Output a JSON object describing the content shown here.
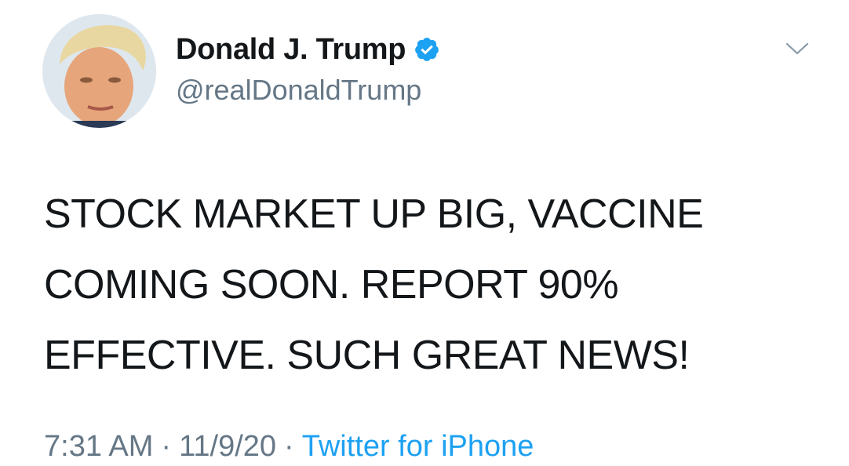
{
  "author": {
    "display_name": "Donald J. Trump",
    "handle": "@realDonaldTrump",
    "verified": true,
    "avatar_icon": "profile-photo",
    "verified_icon": "verified-badge-icon"
  },
  "tweet": {
    "lines": [
      "STOCK MARKET UP BIG, VACCINE",
      "COMING SOON. REPORT 90%",
      "EFFECTIVE. SUCH GREAT NEWS!"
    ]
  },
  "meta": {
    "time": "7:31 AM",
    "separator": "·",
    "date": "11/9/20",
    "source": "Twitter for iPhone"
  },
  "menu": {
    "icon": "chevron-down-icon"
  },
  "colors": {
    "accent": "#1da1f2",
    "text_primary": "#14171a",
    "text_secondary": "#657786",
    "caret": "#8899a6"
  }
}
